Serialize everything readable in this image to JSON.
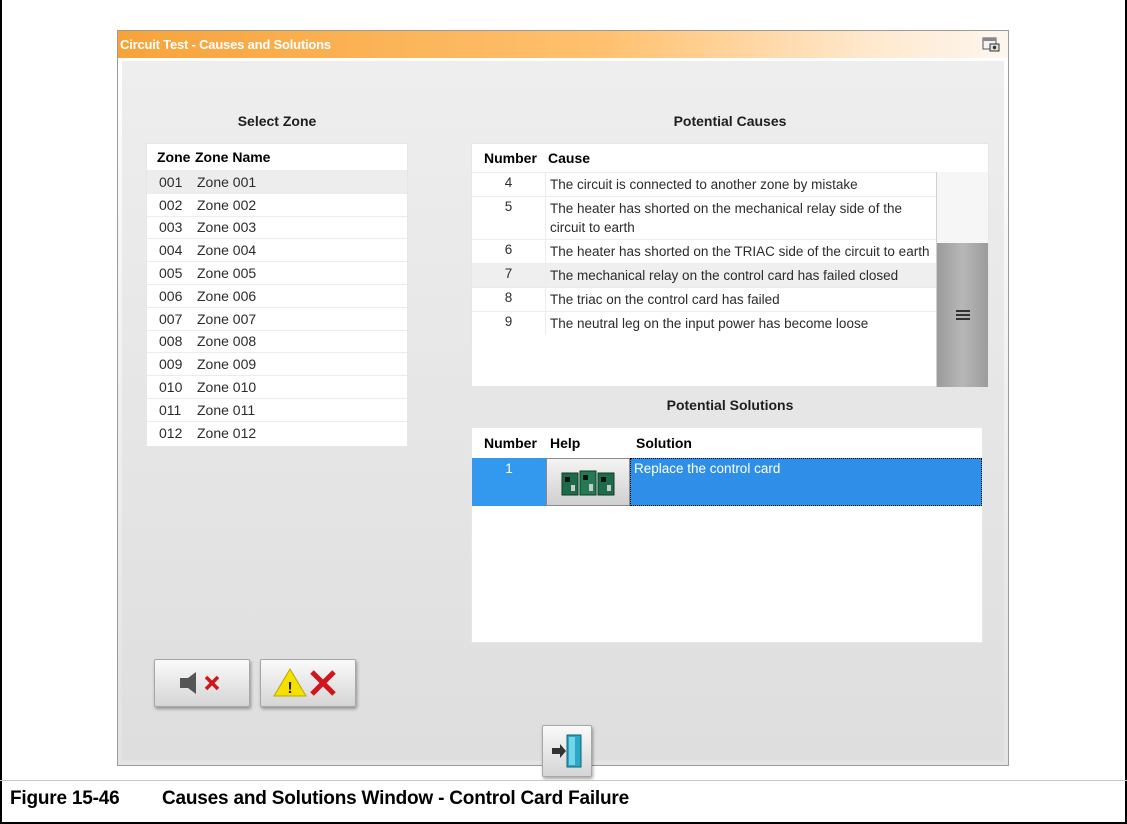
{
  "window": {
    "title": "Circuit Test - Causes and Solutions",
    "title_icon": "window-options-icon"
  },
  "zones": {
    "heading": "Select Zone",
    "columns": [
      "Zone",
      "Zone Name"
    ],
    "rows": [
      {
        "zone": "001",
        "name": "Zone 001",
        "selected": true
      },
      {
        "zone": "002",
        "name": "Zone 002"
      },
      {
        "zone": "003",
        "name": "Zone 003"
      },
      {
        "zone": "004",
        "name": "Zone 004"
      },
      {
        "zone": "005",
        "name": "Zone 005"
      },
      {
        "zone": "006",
        "name": "Zone 006"
      },
      {
        "zone": "007",
        "name": "Zone 007"
      },
      {
        "zone": "008",
        "name": "Zone 008"
      },
      {
        "zone": "009",
        "name": "Zone 009"
      },
      {
        "zone": "010",
        "name": "Zone 010"
      },
      {
        "zone": "011",
        "name": "Zone 011"
      },
      {
        "zone": "012",
        "name": "Zone 012"
      }
    ]
  },
  "causes": {
    "heading": "Potential Causes",
    "columns": [
      "Number",
      "Cause"
    ],
    "rows": [
      {
        "number": "4",
        "cause": "The circuit is connected to another zone by mistake"
      },
      {
        "number": "5",
        "cause": "The heater has shorted on the mechanical relay side of the circuit to earth"
      },
      {
        "number": "6",
        "cause": "The heater has shorted on the TRIAC side of the circuit to earth"
      },
      {
        "number": "7",
        "cause": "The mechanical relay on the control card has failed closed",
        "selected": true
      },
      {
        "number": "8",
        "cause": "The triac on the control card has failed"
      },
      {
        "number": "9",
        "cause": "The neutral leg on the input power has become loose"
      }
    ],
    "scrollbar_icon": "grip-lines-icon"
  },
  "solutions": {
    "heading": "Potential Solutions",
    "columns": [
      "Number",
      "Help",
      "Solution"
    ],
    "rows": [
      {
        "number": "1",
        "help_icon": "control-card-icon",
        "solution": "Replace the control card"
      }
    ],
    "selected_color": "#3399ee"
  },
  "buttons": {
    "mute_icon": "speaker-mute-icon",
    "alarm_reset_icon": "warning-clear-icon",
    "exit_icon": "exit-door-icon"
  },
  "caption": {
    "number": "Figure 15-46",
    "text": "Causes and Solutions Window - Control Card Failure"
  },
  "colors": {
    "title_bar_start": "#f7a33a",
    "selection": "#3399ee",
    "x_red": "#d0161c",
    "warning_yellow": "#f5e000"
  }
}
